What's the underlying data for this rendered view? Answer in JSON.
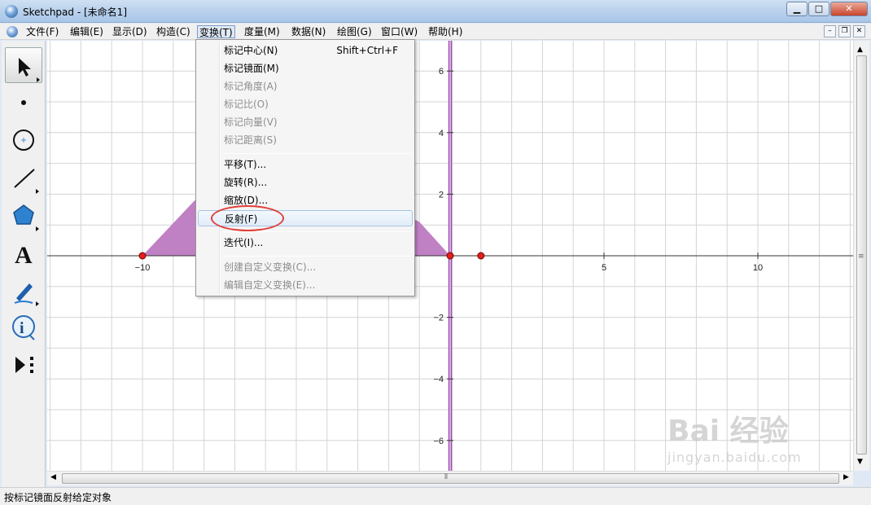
{
  "window": {
    "app_name": "Sketchpad",
    "doc_title": "[未命名1]",
    "minimize": "▁",
    "maximize": "□",
    "close": "✕"
  },
  "menubar": {
    "items": [
      {
        "label": "文件(F)"
      },
      {
        "label": "编辑(E)"
      },
      {
        "label": "显示(D)"
      },
      {
        "label": "构造(C)"
      },
      {
        "label": "变换(T)",
        "active": true
      },
      {
        "label": "度量(M)"
      },
      {
        "label": "数据(N)"
      },
      {
        "label": "绘图(G)"
      },
      {
        "label": "窗口(W)"
      },
      {
        "label": "帮助(H)"
      }
    ]
  },
  "doc_controls": {
    "minimize": "–",
    "restore": "❐",
    "close": "✕"
  },
  "toolbar": {
    "tools": [
      {
        "name": "arrow-select-tool",
        "selected": true
      },
      {
        "name": "point-tool"
      },
      {
        "name": "compass-tool"
      },
      {
        "name": "straightedge-tool"
      },
      {
        "name": "polygon-tool"
      },
      {
        "name": "text-tool",
        "glyph": "A"
      },
      {
        "name": "marker-tool"
      },
      {
        "name": "information-tool",
        "glyph": "i"
      },
      {
        "name": "custom-tool"
      }
    ]
  },
  "transform_menu": {
    "items": [
      {
        "label": "标记中心(N)",
        "shortcut": "Shift+Ctrl+F",
        "disabled": false
      },
      {
        "label": "标记镜面(M)",
        "disabled": false
      },
      {
        "label": "标记角度(A)",
        "disabled": true
      },
      {
        "label": "标记比(O)",
        "disabled": true
      },
      {
        "label": "标记向量(V)",
        "disabled": true
      },
      {
        "label": "标记距离(S)",
        "disabled": true
      },
      {
        "separator": true
      },
      {
        "label": "平移(T)...",
        "disabled": false
      },
      {
        "label": "旋转(R)...",
        "disabled": false
      },
      {
        "label": "缩放(D)...",
        "disabled": false
      },
      {
        "label": "反射(F)",
        "disabled": false,
        "highlighted": true
      },
      {
        "separator": true
      },
      {
        "label": "迭代(I)...",
        "disabled": false
      },
      {
        "separator": true
      },
      {
        "label": "创建自定义变换(C)...",
        "disabled": true
      },
      {
        "label": "编辑自定义变换(E)...",
        "disabled": true
      }
    ]
  },
  "graph": {
    "x_ticks": [
      -10,
      5,
      10
    ],
    "x_tick_labels": [
      "−10",
      "5",
      "10"
    ],
    "y_ticks": [
      6,
      4,
      2,
      -2,
      -4,
      -6
    ],
    "y_tick_labels": [
      "6",
      "4",
      "2",
      "−2",
      "−4",
      "−6"
    ],
    "polygon_color": "#c080c4",
    "mirror_line_color": "#9b4ca9",
    "points": [
      {
        "x": -10,
        "y": 0
      },
      {
        "x": 0,
        "y": 0
      },
      {
        "x": 1,
        "y": 0
      }
    ],
    "point_color": "#e0201a"
  },
  "status": {
    "text": "按标记镜面反射给定对象"
  },
  "watermark": {
    "line1": "Bai 经验",
    "line2": "jingyan.baidu.com"
  }
}
